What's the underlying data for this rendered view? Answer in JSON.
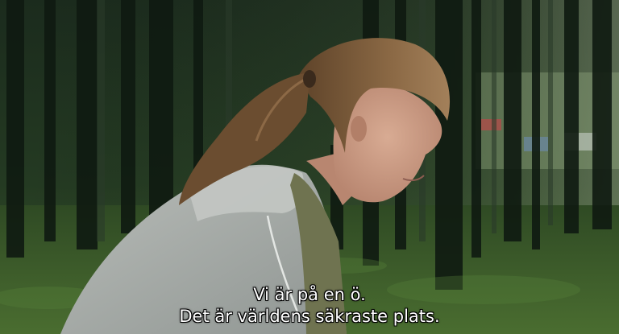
{
  "subtitles": {
    "line1": "Vi är på en ö.",
    "line2": "Det är världens säkraste plats."
  },
  "colors": {
    "forest_dark": "#142015",
    "forest_mid": "#26391f",
    "moss_ground": "#3f5e2a",
    "jacket_gray": "#a9aeab",
    "hair_brown": "#7a5a3c",
    "skin": "#c99a82",
    "subtitle_text": "#ffffff"
  }
}
